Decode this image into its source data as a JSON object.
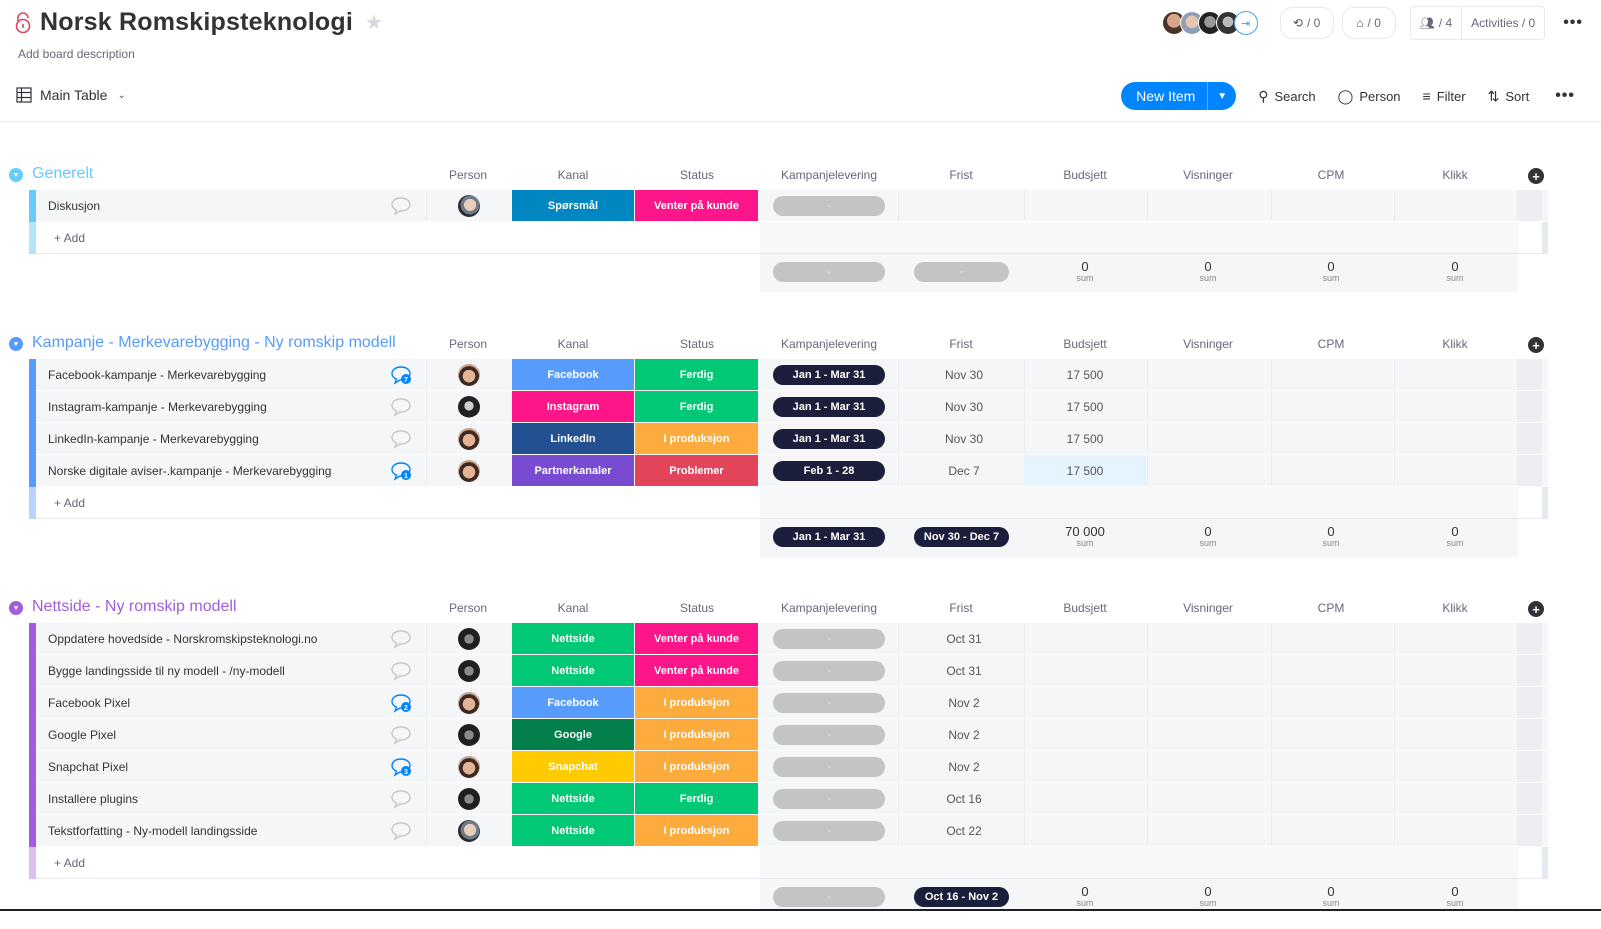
{
  "header": {
    "title": "Norsk Romskipsteknologi",
    "description": "Add board description",
    "view": "Main Table",
    "avatars": [
      "user-1",
      "user-2",
      "user-3",
      "user-4"
    ],
    "integrations_count": "/ 0",
    "automations_count": "/ 0",
    "members_count": "/ 4",
    "activities": "Activities / 0"
  },
  "toolbar": {
    "new_item": "New Item",
    "search": "Search",
    "person": "Person",
    "filter": "Filter",
    "sort": "Sort"
  },
  "columns": [
    "Person",
    "Kanal",
    "Status",
    "Kampanjelevering",
    "Frist",
    "Budsjett",
    "Visninger",
    "CPM",
    "Klikk"
  ],
  "add_label": "+ Add",
  "sum_label": "sum",
  "colors": {
    "kanal": {
      "Spørsmål": "#0086c0",
      "Facebook": "#579bfc",
      "Instagram": "#ff158a",
      "LinkedIn": "#225091",
      "Partnerkanaler": "#784bd1",
      "Nettside": "#00c875",
      "Google": "#037f4c",
      "Snapchat": "#ffcb00"
    },
    "status": {
      "Venter på kunde": "#ff158a",
      "Ferdig": "#00c875",
      "I produksjon": "#fdab3d",
      "Problemer": "#e2445c"
    }
  },
  "groups": [
    {
      "title": "Generelt",
      "color": "#66ccff",
      "bar_color": "#66ccff",
      "add_bar_color": "#b3e5fc",
      "items": [
        {
          "name": "Diskusjon",
          "comments": null,
          "person": "p-bald",
          "kanal": "Spørsmål",
          "status": "Venter på kunde",
          "kampanjelevering": "-",
          "frist": "",
          "budsjett": ""
        }
      ],
      "summary": {
        "kampanjelevering": "-",
        "frist": "-",
        "budsjett": "0",
        "visninger": "0",
        "cpm": "0",
        "klikk": "0"
      }
    },
    {
      "title": "Kampanje - Merkevarebygging - Ny romskip modell",
      "color": "#579bfc",
      "bar_color": "#579bfc",
      "add_bar_color": "#b8d3fd",
      "items": [
        {
          "name": "Facebook-kampanje - Merkevarebygging",
          "comments": "7",
          "person": "p-asian",
          "kanal": "Facebook",
          "status": "Ferdig",
          "kampanjelevering": "Jan 1 - Mar 31",
          "frist": "Nov 30",
          "budsjett": "17 500"
        },
        {
          "name": "Instagram-kampanje - Merkevarebygging",
          "comments": null,
          "person": "p-woman",
          "kanal": "Instagram",
          "status": "Ferdig",
          "kampanjelevering": "Jan 1 - Mar 31",
          "frist": "Nov 30",
          "budsjett": "17 500"
        },
        {
          "name": "LinkedIn-kampanje - Merkevarebygging",
          "comments": null,
          "person": "p-asian",
          "kanal": "LinkedIn",
          "status": "I produksjon",
          "kampanjelevering": "Jan 1 - Mar 31",
          "frist": "Nov 30",
          "budsjett": "17 500"
        },
        {
          "name": "Norske digitale aviser-.kampanje - Merkevarebygging",
          "comments": "1",
          "person": "p-asian",
          "kanal": "Partnerkanaler",
          "status": "Problemer",
          "kampanjelevering": "Feb 1 - 28",
          "frist": "Dec 7",
          "budsjett": "17 500",
          "budsjett_highlight": true
        }
      ],
      "summary": {
        "kampanjelevering": "Jan 1 - Mar 31",
        "frist": "Nov 30 - Dec 7",
        "budsjett": "70 000",
        "visninger": "0",
        "cpm": "0",
        "klikk": "0"
      }
    },
    {
      "title": "Nettside - Ny romskip modell",
      "color": "#a25ddc",
      "bar_color": "#a25ddc",
      "add_bar_color": "#dcc0f2",
      "items": [
        {
          "name": "Oppdatere hovedside - Norskromskipsteknologi.no",
          "comments": null,
          "person": "p-dark",
          "kanal": "Nettside",
          "status": "Venter på kunde",
          "kampanjelevering": "-",
          "frist": "Oct 31",
          "budsjett": ""
        },
        {
          "name": "Bygge landingsside til ny modell - /ny-modell",
          "comments": null,
          "person": "p-dark",
          "kanal": "Nettside",
          "status": "Venter på kunde",
          "kampanjelevering": "-",
          "frist": "Oct 31",
          "budsjett": ""
        },
        {
          "name": "Facebook Pixel",
          "comments": "2",
          "person": "p-asian",
          "kanal": "Facebook",
          "status": "I produksjon",
          "kampanjelevering": "-",
          "frist": "Nov 2",
          "budsjett": ""
        },
        {
          "name": "Google Pixel",
          "comments": null,
          "person": "p-dark",
          "kanal": "Google",
          "status": "I produksjon",
          "kampanjelevering": "-",
          "frist": "Nov 2",
          "budsjett": ""
        },
        {
          "name": "Snapchat Pixel",
          "comments": "3",
          "person": "p-asian",
          "kanal": "Snapchat",
          "status": "I produksjon",
          "kampanjelevering": "-",
          "frist": "Nov 2",
          "budsjett": ""
        },
        {
          "name": "Installere plugins",
          "comments": null,
          "person": "p-dark",
          "kanal": "Nettside",
          "status": "Ferdig",
          "kampanjelevering": "-",
          "frist": "Oct 16",
          "budsjett": ""
        },
        {
          "name": "Tekstforfatting - Ny-modell landingsside",
          "comments": null,
          "person": "p-bald",
          "kanal": "Nettside",
          "status": "I produksjon",
          "kampanjelevering": "-",
          "frist": "Oct 22",
          "budsjett": ""
        }
      ],
      "summary": {
        "kampanjelevering": "-",
        "frist": "Oct 16 - Nov 2",
        "budsjett": "0",
        "visninger": "0",
        "cpm": "0",
        "klikk": "0"
      }
    }
  ]
}
